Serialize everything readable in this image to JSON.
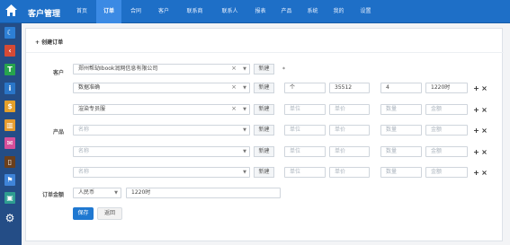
{
  "app": {
    "title": "客户管理"
  },
  "nav": [
    "首页",
    "订单",
    "合同",
    "客户",
    "联系商",
    "联系人",
    "报表",
    "产品",
    "系统",
    "我的",
    "设置"
  ],
  "sidebar": {
    "icons": [
      {
        "name": "moon-icon",
        "glyph": "☾",
        "color": "#2d7fd5"
      },
      {
        "name": "left-arrow-icon",
        "glyph": "‹",
        "color": "#d54a35"
      },
      {
        "name": "tag-icon",
        "glyph": "T",
        "color": "#27a44d"
      },
      {
        "name": "info-icon",
        "glyph": "i",
        "color": "#2a76c8"
      },
      {
        "name": "dollar-icon",
        "glyph": "$",
        "color": "#e4a02b"
      },
      {
        "name": "chart-icon",
        "glyph": "▥",
        "color": "#e69b2d"
      },
      {
        "name": "mail-icon",
        "glyph": "✉",
        "color": "#d64f9a"
      },
      {
        "name": "notebook-icon",
        "glyph": "▯",
        "color": "#6b3f1d"
      },
      {
        "name": "flag-icon",
        "glyph": "⚑",
        "color": "#3f84d8"
      },
      {
        "name": "cube-icon",
        "glyph": "▣",
        "color": "#2e9d91"
      },
      {
        "name": "gear-icon",
        "glyph": "⚙",
        "color": "#244d86"
      }
    ]
  },
  "form": {
    "title": "创建订单",
    "labels": {
      "customer": "客户",
      "product": "产品",
      "order_amount": "订单金额"
    },
    "customer": {
      "value": "郑州帮劫Ibook润网信息有限公司",
      "new_label": "新建",
      "asterisk": "*"
    },
    "product_rows": [
      {
        "product": "数据准确",
        "new_label": "新建",
        "unit": "个",
        "price": "35512",
        "qty": "4",
        "amount": "1220时"
      },
      {
        "product": "渲染专员服",
        "new_label": "新建",
        "unit": "单位",
        "price": "单价",
        "qty": "数量",
        "amount": "金额"
      },
      {
        "product": "名称",
        "new_label": "新建",
        "unit": "单位",
        "price": "单价",
        "qty": "数量",
        "amount": "金额"
      },
      {
        "product": "名称",
        "new_label": "新建",
        "unit": "单位",
        "price": "单价",
        "qty": "数量",
        "amount": "金额"
      },
      {
        "product": "名称",
        "new_label": "新建",
        "unit": "单位",
        "price": "单价",
        "qty": "数量",
        "amount": "金额"
      }
    ],
    "order_amount": {
      "currency": "人民币",
      "value": "1220时"
    },
    "buttons": {
      "save": "保存",
      "back": "返回"
    }
  },
  "icons": {
    "plus": "+",
    "close": "×",
    "down": "▼",
    "clear": "×"
  }
}
